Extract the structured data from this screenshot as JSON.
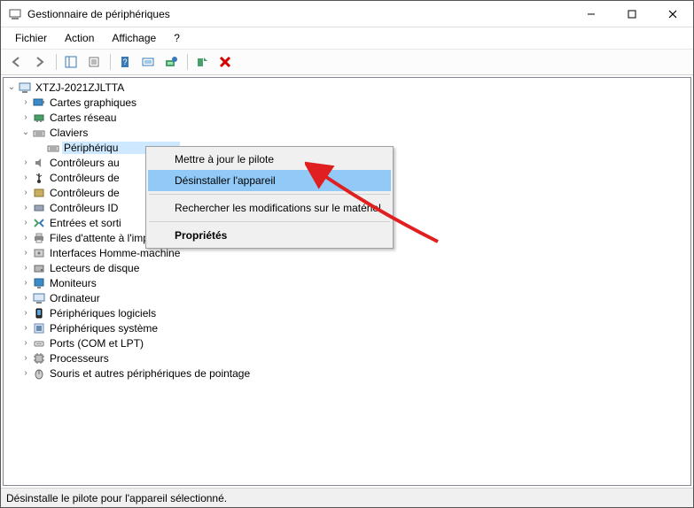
{
  "window": {
    "title": "Gestionnaire de périphériques"
  },
  "menu": {
    "file": "Fichier",
    "action": "Action",
    "view": "Affichage",
    "help": "?"
  },
  "tree": {
    "root": "XTZJ-2021ZJLTTA",
    "nodes": {
      "graphics": "Cartes graphiques",
      "network": "Cartes réseau",
      "keyboards": "Claviers",
      "keyboard_child": "Périphériqu",
      "audio_ctrl": "Contrôleurs au",
      "bus_ctrl": "Contrôleurs de",
      "storage_ctrl": "Contrôleurs de",
      "ide_ctrl": "Contrôleurs ID",
      "io": "Entrées et sorti",
      "print_queues": "Files d'attente à l'impression",
      "hid": "Interfaces Homme-machine",
      "disk": "Lecteurs de disque",
      "monitors": "Moniteurs",
      "computer": "Ordinateur",
      "software_devices": "Périphériques logiciels",
      "system_devices": "Périphériques système",
      "ports": "Ports (COM et LPT)",
      "processors": "Processeurs",
      "mice": "Souris et autres périphériques de pointage"
    }
  },
  "context_menu": {
    "update": "Mettre à jour le pilote",
    "uninstall": "Désinstaller l'appareil",
    "scan": "Rechercher les modifications sur le matériel",
    "properties": "Propriétés"
  },
  "status": {
    "text": "Désinstalle le pilote pour l'appareil sélectionné."
  }
}
